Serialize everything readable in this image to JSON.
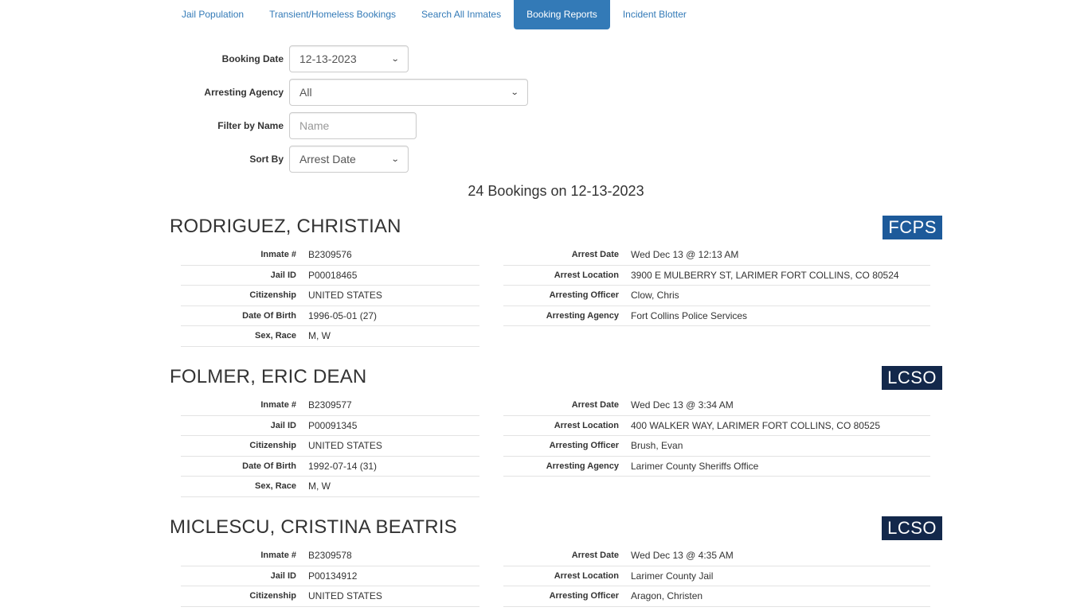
{
  "nav": {
    "items": [
      {
        "label": "Jail Population"
      },
      {
        "label": "Transient/Homeless Bookings"
      },
      {
        "label": "Search All Inmates"
      },
      {
        "label": "Booking Reports"
      },
      {
        "label": "Incident Blotter"
      }
    ],
    "active_index": 3
  },
  "filters": {
    "booking_date": {
      "label": "Booking Date",
      "value": "12-13-2023"
    },
    "arresting_agency": {
      "label": "Arresting Agency",
      "value": "All"
    },
    "filter_by_name": {
      "label": "Filter by Name",
      "placeholder": "Name",
      "value": ""
    },
    "sort_by": {
      "label": "Sort By",
      "value": "Arrest Date"
    }
  },
  "summary": "24 Bookings on 12-13-2023",
  "field_labels": {
    "inmate_no": "Inmate #",
    "jail_id": "Jail ID",
    "citizenship": "Citizenship",
    "dob": "Date Of Birth",
    "sex_race": "Sex, Race",
    "arrest_date": "Arrest Date",
    "arrest_location": "Arrest Location",
    "arresting_officer": "Arresting Officer",
    "arresting_agency": "Arresting Agency"
  },
  "bookings": [
    {
      "name": "RODRIGUEZ, CHRISTIAN",
      "agency_badge": "FCPS",
      "inmate_no": "B2309576",
      "jail_id": "P00018465",
      "citizenship": "UNITED STATES",
      "dob": "1996-05-01 (27)",
      "sex_race": "M, W",
      "arrest_date": "Wed Dec 13 @ 12:13 AM",
      "arrest_location": "3900 E MULBERRY ST, LARIMER FORT COLLINS, CO 80524",
      "arresting_officer": "Clow, Chris",
      "arresting_agency": "Fort Collins Police Services"
    },
    {
      "name": "FOLMER, ERIC DEAN",
      "agency_badge": "LCSO",
      "inmate_no": "B2309577",
      "jail_id": "P00091345",
      "citizenship": "UNITED STATES",
      "dob": "1992-07-14 (31)",
      "sex_race": "M, W",
      "arrest_date": "Wed Dec 13 @ 3:34 AM",
      "arrest_location": "400 WALKER WAY, LARIMER FORT COLLINS, CO 80525",
      "arresting_officer": "Brush, Evan",
      "arresting_agency": "Larimer County Sheriffs Office"
    },
    {
      "name": "MICLESCU, CRISTINA BEATRIS",
      "agency_badge": "LCSO",
      "inmate_no": "B2309578",
      "jail_id": "P00134912",
      "citizenship": "UNITED STATES",
      "arrest_date": "Wed Dec 13 @ 4:35 AM",
      "arrest_location": "Larimer County Jail",
      "arresting_officer": "Aragon, Christen"
    }
  ],
  "colors": {
    "link": "#337ab7",
    "active_tab": "#337ab7",
    "badge_fcps": "#1d5a9a",
    "badge_lcso": "#13284b"
  }
}
